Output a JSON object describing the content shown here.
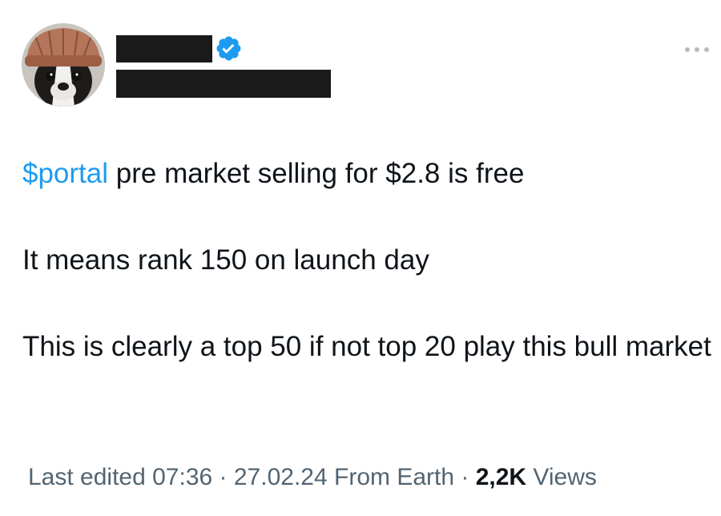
{
  "tweet": {
    "cashtag": "$portal",
    "line1_rest": " pre market selling for $2.8 is free",
    "line2": "It means rank 150 on launch day",
    "line3": "This is clearly a top 50 if not top 20 play this bull market"
  },
  "meta": {
    "edited_label": "Last edited 07:36",
    "separator": "·",
    "date": "27.02.24",
    "source": "From Earth",
    "views_count": "2,2K",
    "views_label": " Views"
  },
  "colors": {
    "link_blue": "#1d9bf0",
    "text_primary": "#0f1419",
    "text_secondary": "#536471",
    "redaction": "#1a1a1a"
  },
  "icons": {
    "verified": "verified-badge-icon",
    "more": "more-options-icon"
  }
}
